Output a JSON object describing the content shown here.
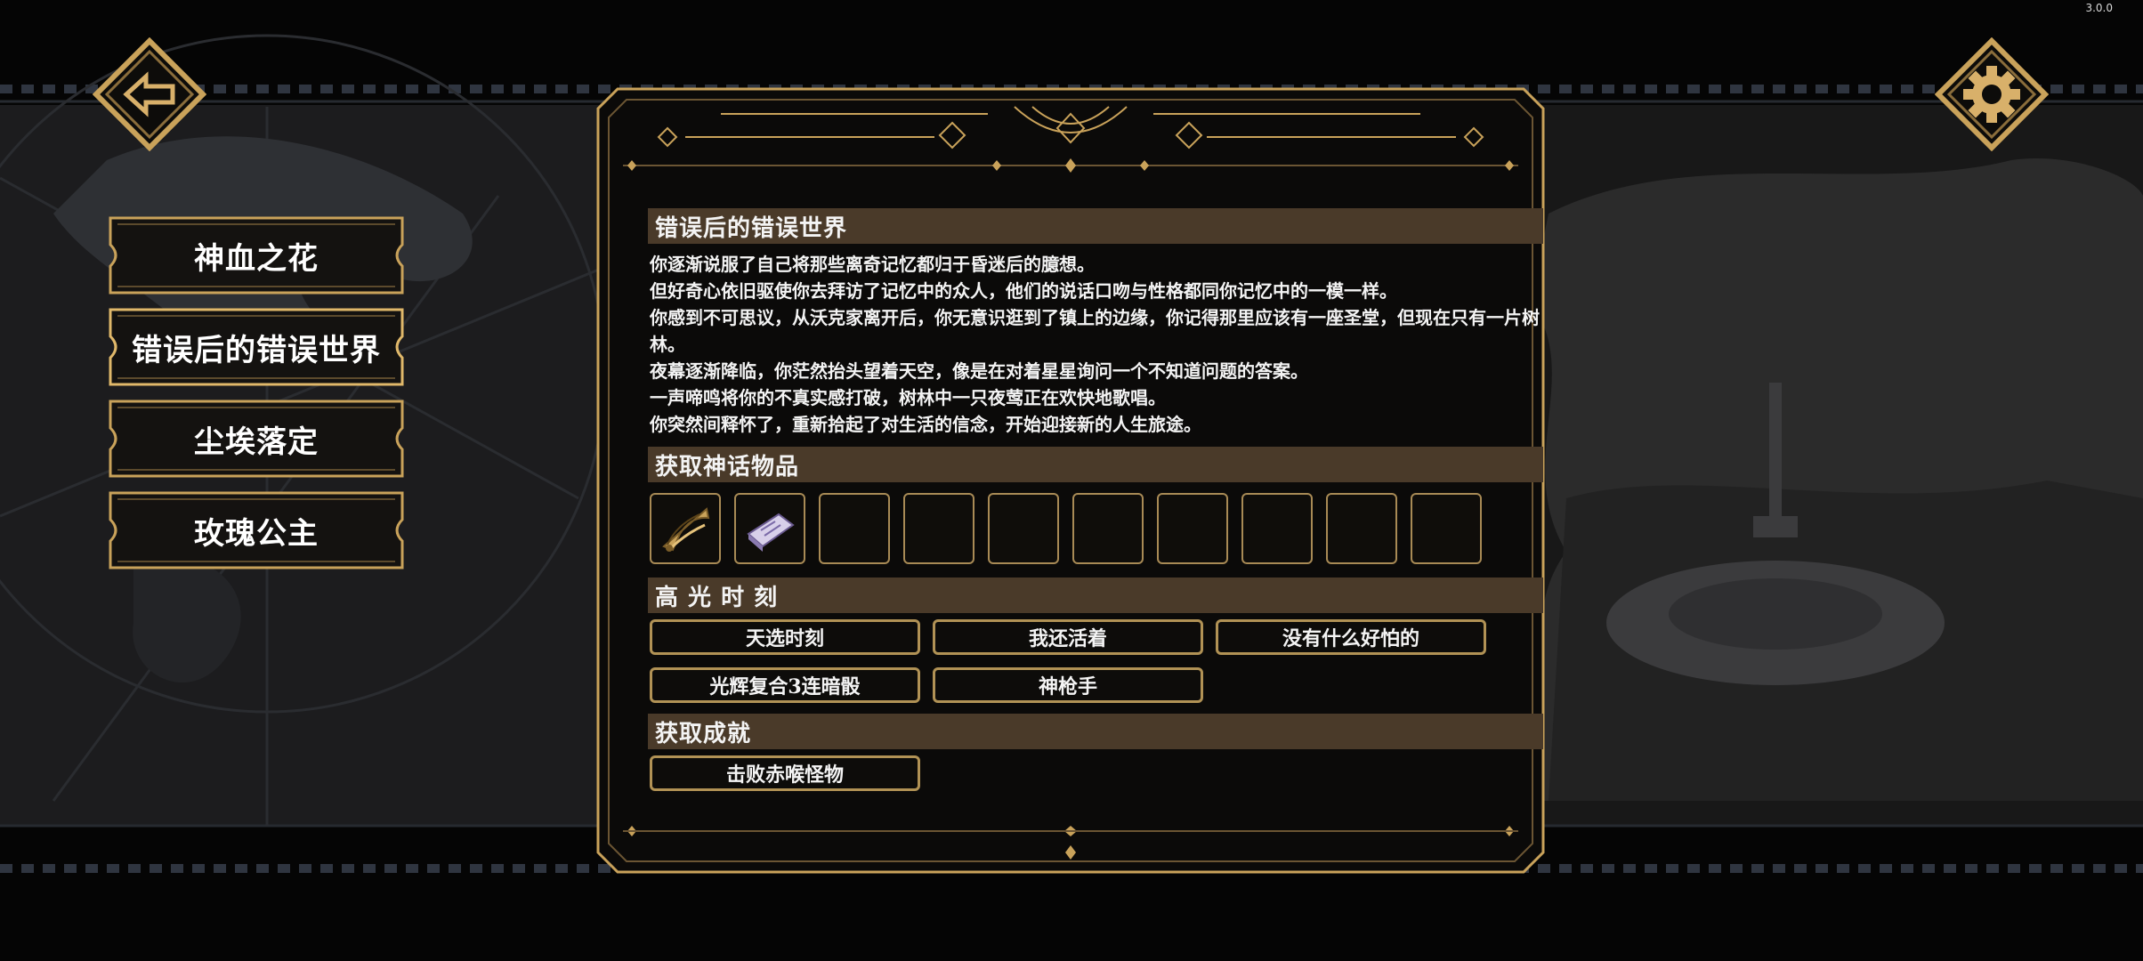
{
  "version": "3.0.0",
  "colors": {
    "gold": "#c9a25a",
    "header_bg": "#4a3a29",
    "slot_border": "#a88a55"
  },
  "nav": {
    "back_icon": "back-arrow-icon",
    "settings_icon": "gear-icon"
  },
  "chapters": [
    {
      "label": "神血之花"
    },
    {
      "label": "错误后的错误世界",
      "selected": true
    },
    {
      "label": "尘埃落定"
    },
    {
      "label": "玫瑰公主"
    }
  ],
  "panel": {
    "title": "错误后的错误世界",
    "story_lines": [
      "你逐渐说服了自己将那些离奇记忆都归于昏迷后的臆想。",
      "但好奇心依旧驱使你去拜访了记忆中的众人，他们的说话口吻与性格都同你记忆中的一模一样。",
      "你感到不可思议，从沃克家离开后，你无意识逛到了镇上的边缘，你记得那里应该有一座圣堂，但现在只有一片树林。",
      "夜幕逐渐降临，你茫然抬头望着天空，像是在对着星星询问一个不知道问题的答案。",
      "一声啼鸣将你的不真实感打破，树林中一只夜莺正在欢快地歌唱。",
      "你突然间释怀了，重新拾起了对生活的信念，开始迎接新的人生旅途。"
    ],
    "items_header": "获取神话物品",
    "item_slots": [
      {
        "icon": "golden-fan-icon",
        "filled": true
      },
      {
        "icon": "spellbook-icon",
        "filled": true
      },
      {
        "filled": false
      },
      {
        "filled": false
      },
      {
        "filled": false
      },
      {
        "filled": false
      },
      {
        "filled": false
      },
      {
        "filled": false
      },
      {
        "filled": false
      },
      {
        "filled": false
      }
    ],
    "highlights_header": "高 光 时 刻",
    "highlights": [
      "天选时刻",
      "我还活着",
      "没有什么好怕的",
      "光辉复合3连暗骰",
      "神枪手"
    ],
    "achievements_header": "获取成就",
    "achievements": [
      "击败赤喉怪物"
    ]
  }
}
